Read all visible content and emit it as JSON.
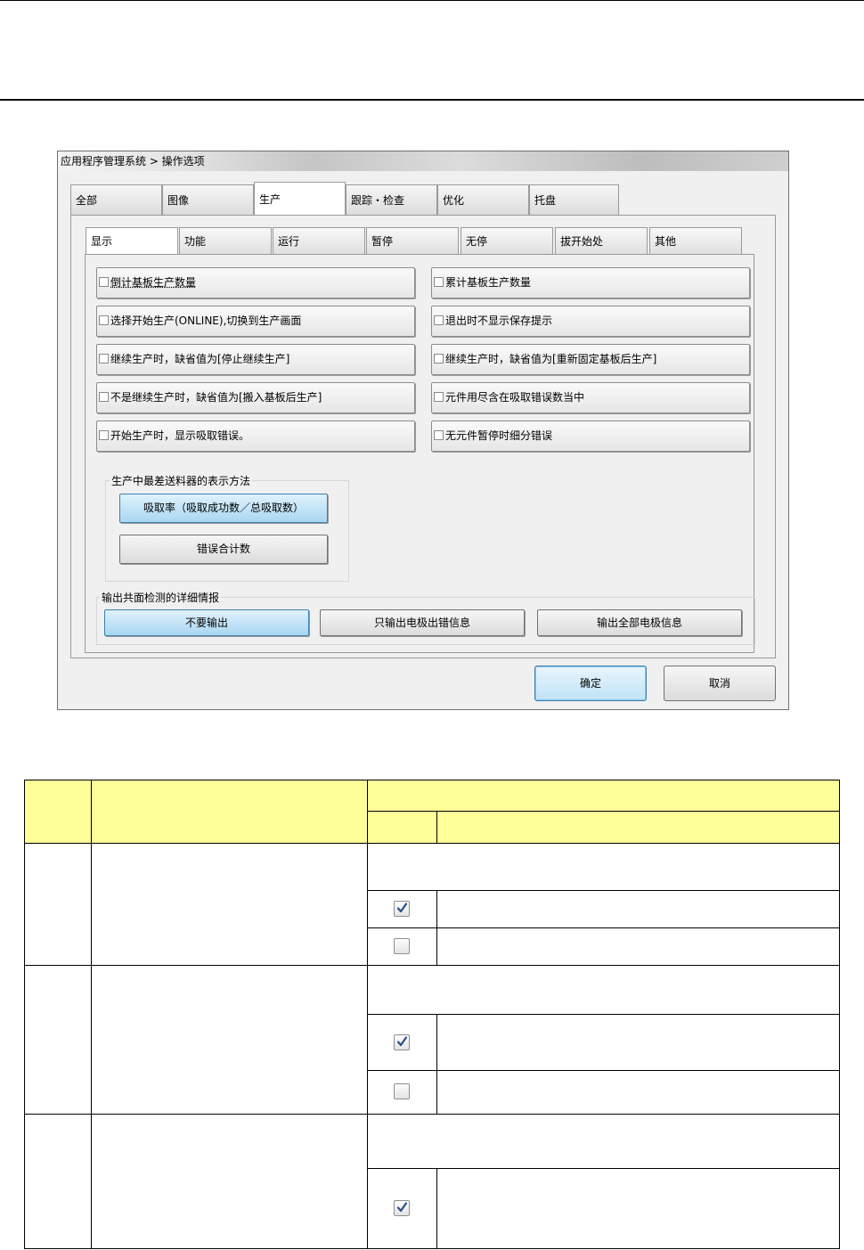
{
  "dialog": {
    "title": "应用程序管理系统 > 操作选项",
    "tabs": [
      "全部",
      "图像",
      "生产",
      "跟踪・检查",
      "优化",
      "托盘"
    ],
    "active_tab": "生产",
    "subtabs": [
      "显示",
      "功能",
      "运行",
      "暂停",
      "无停",
      "拔开始处",
      "其他"
    ],
    "active_subtab": "显示",
    "options_left": [
      "倒计基板生产数量",
      "选择开始生产(ONLINE),切换到生产画面",
      "继续生产时，缺省值为[停止继续生产]",
      "不是继续生产时，缺省值为[搬入基板后生产]",
      "开始生产时，显示吸取错误。"
    ],
    "options_right": [
      "累计基板生产数量",
      "退出时不显示保存提示",
      "继续生产时，缺省值为[重新固定基板后生产]",
      "元件用尽含在吸取错误数当中",
      "无元件暂停时细分错误"
    ],
    "feeder_group": {
      "label": "生产中最差送料器的表示方法",
      "buttons": [
        "吸取率（吸取成功数／总吸取数）",
        "错误合计数"
      ],
      "selected": 0
    },
    "output_group": {
      "label": "输出共面检测的详细情报",
      "buttons": [
        "不要输出",
        "只输出电极出错信息",
        "输出全部电极信息"
      ],
      "selected": 0
    },
    "ok_label": "确定",
    "cancel_label": "取消"
  },
  "table": {
    "checkbox_states": [
      true,
      false,
      true,
      false,
      true
    ]
  }
}
